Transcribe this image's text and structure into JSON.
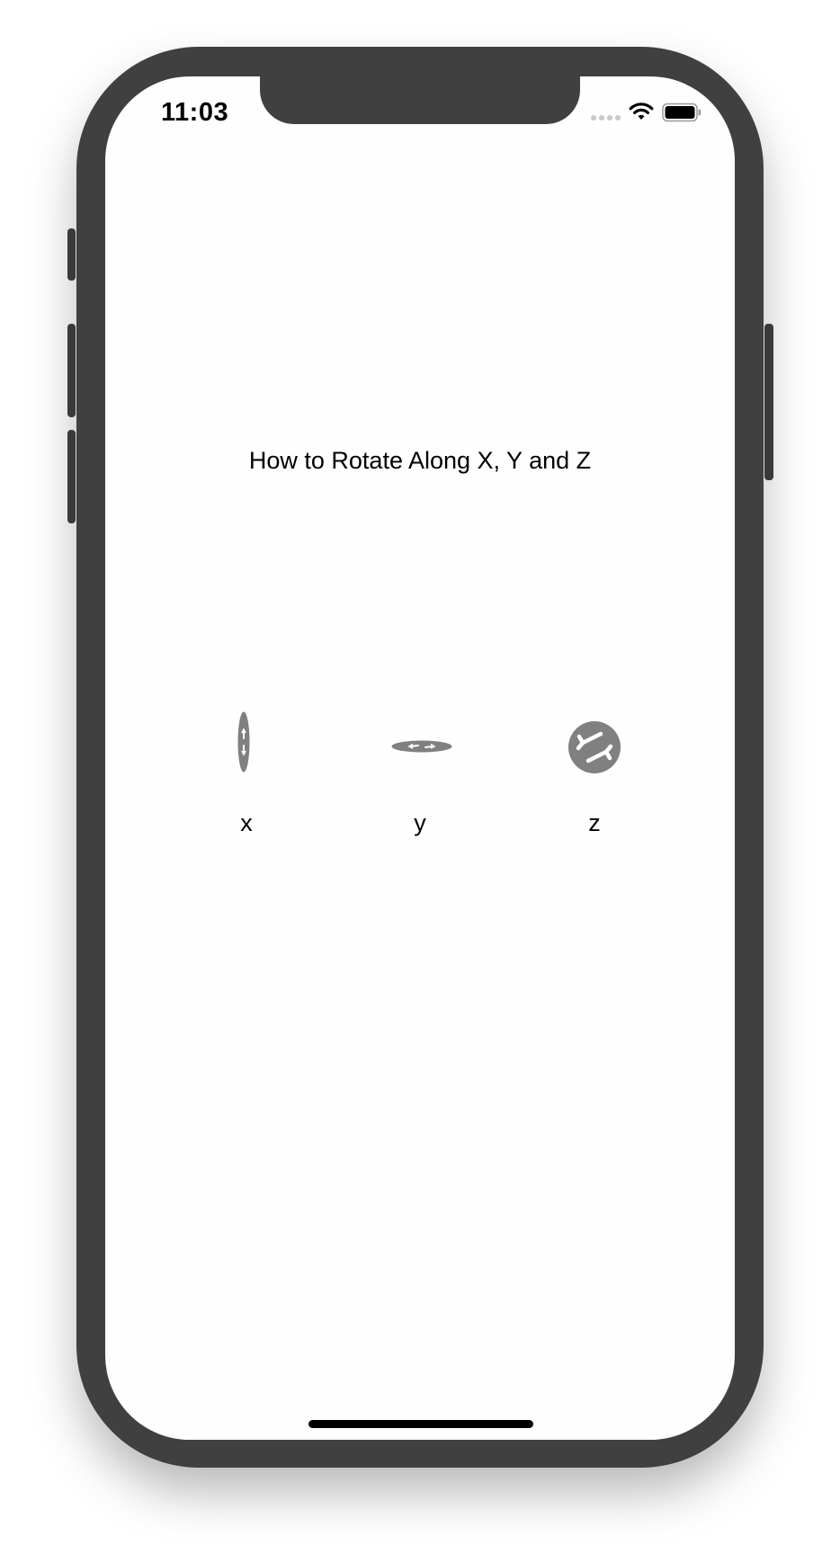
{
  "status_bar": {
    "time": "11:03"
  },
  "title": "How to Rotate Along X, Y and Z",
  "rotations": [
    {
      "axis_label": "x",
      "icon": "rotate-arrows-icon"
    },
    {
      "axis_label": "y",
      "icon": "rotate-arrows-icon"
    },
    {
      "axis_label": "z",
      "icon": "rotate-arrows-icon"
    }
  ],
  "colors": {
    "disc_fill": "#808080",
    "device_frame": "#404040",
    "screen_background": "#fefefe"
  }
}
